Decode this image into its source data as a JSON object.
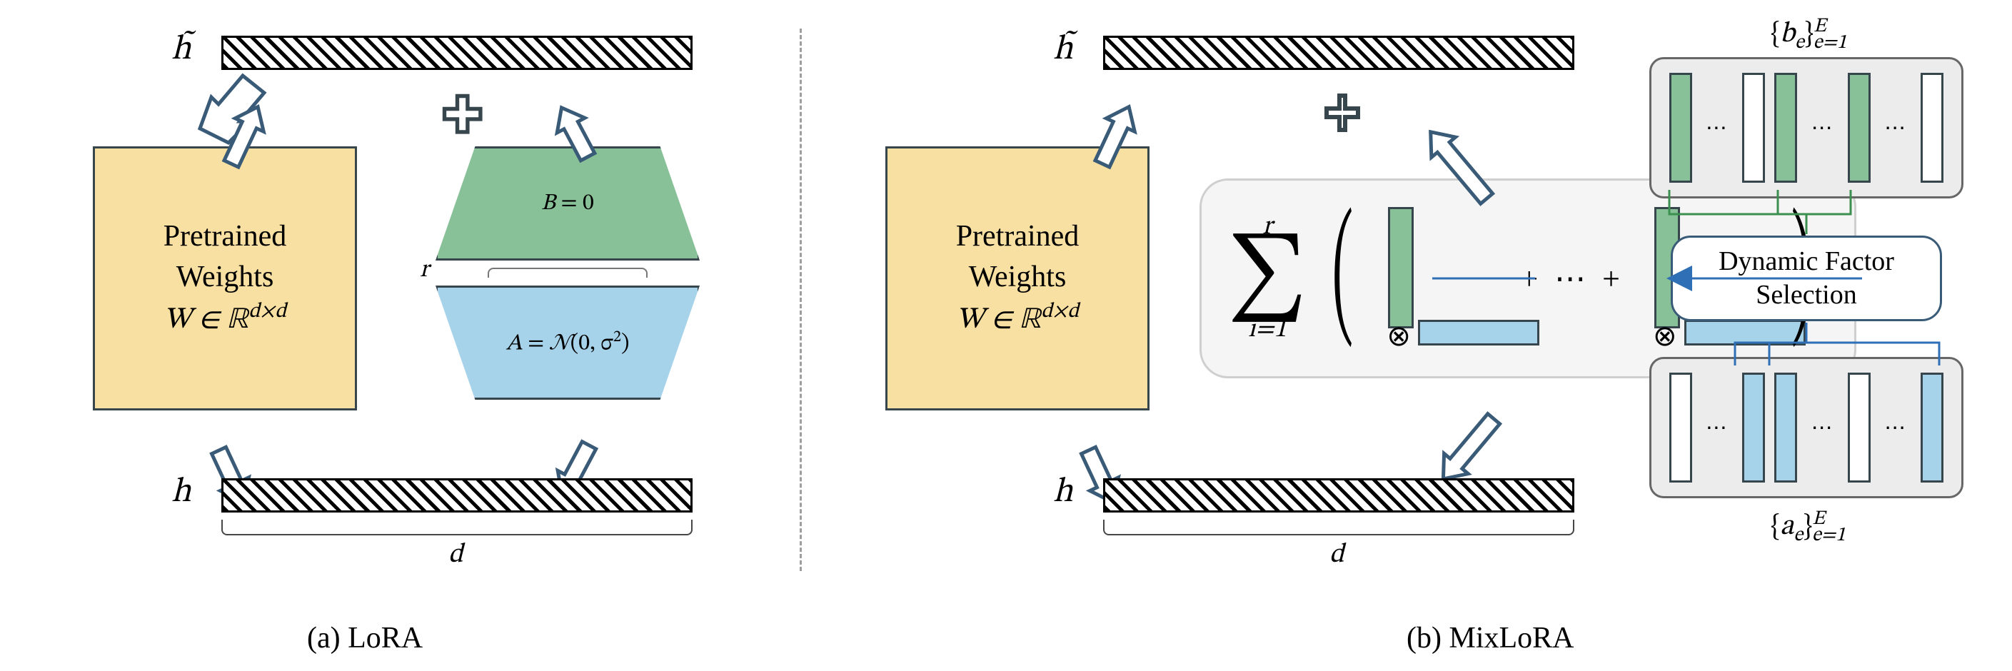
{
  "captions": {
    "lora": "(a) LoRA",
    "mixlora": "(b) MixLoRA"
  },
  "lora": {
    "h_tilde": "h̃",
    "h": "h",
    "pretrained_l1": "Pretrained",
    "pretrained_l2": "Weights",
    "pretrained_w": "W ∈ ℝ",
    "pretrained_dim": "d×d",
    "B_label": "B = 0",
    "A_label": "A = 𝒩(0, σ²)",
    "r_label": "r",
    "d_label": "d"
  },
  "mixlora": {
    "h_tilde": "h̃",
    "h": "h",
    "pretrained_l1": "Pretrained",
    "pretrained_l2": "Weights",
    "pretrained_w": "W ∈ ℝ",
    "pretrained_dim": "d×d",
    "d_label": "d",
    "sum_upper": "r",
    "sum_lower": "i=1",
    "plusdots": "+ ⋯ +",
    "dfs_l1": "Dynamic Factor",
    "dfs_l2": "Selection",
    "pool_b_label_left": "{b",
    "pool_b_label_sub": "e",
    "pool_b_label_right": "}",
    "pool_b_label_top": "E",
    "pool_b_label_bottom": "e=1",
    "pool_a_label_left": "{a",
    "pool_a_label_sub": "e",
    "pool_a_label_right": "}",
    "pool_a_label_top": "E",
    "pool_a_label_bottom": "e=1",
    "ellipsis": "⋯"
  }
}
